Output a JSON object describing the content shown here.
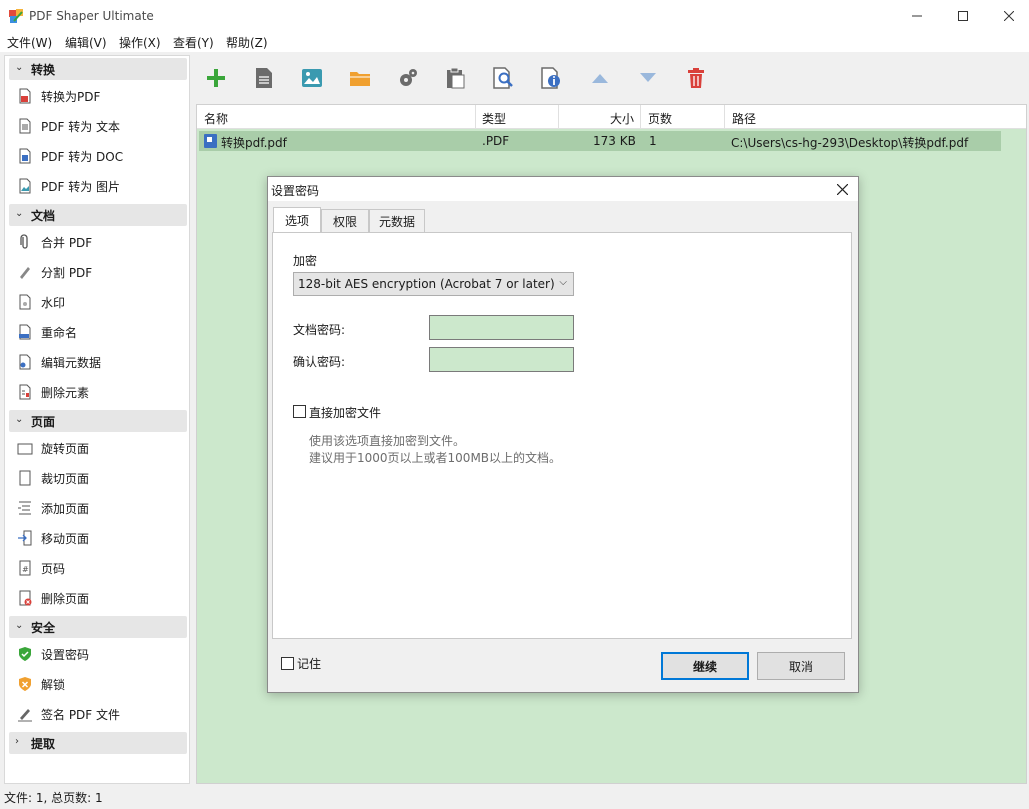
{
  "window": {
    "title": "PDF Shaper Ultimate"
  },
  "menu": [
    "文件(W)",
    "编辑(V)",
    "操作(X)",
    "查看(Y)",
    "帮助(Z)"
  ],
  "sidebar": {
    "sections": [
      {
        "label": "转换",
        "items": [
          "转换为PDF",
          "PDF 转为 文本",
          "PDF 转为 DOC",
          "PDF 转为 图片"
        ]
      },
      {
        "label": "文档",
        "items": [
          "合并 PDF",
          "分割 PDF",
          "水印",
          "重命名",
          "编辑元数据",
          "删除元素"
        ]
      },
      {
        "label": "页面",
        "items": [
          "旋转页面",
          "裁切页面",
          "添加页面",
          "移动页面",
          "页码",
          "删除页面"
        ]
      },
      {
        "label": "安全",
        "items": [
          "设置密码",
          "解锁",
          "签名 PDF 文件"
        ]
      },
      {
        "label": "提取",
        "items": []
      }
    ]
  },
  "toolbar": {
    "icons": [
      "add-icon",
      "document-icon",
      "image-icon",
      "folder-icon",
      "settings-icon",
      "clipboard-icon",
      "search-document-icon",
      "info-icon",
      "arrow-up-icon",
      "arrow-down-icon",
      "delete-icon"
    ],
    "colors": {
      "green": "#3aa63a",
      "gray": "#6b6b6b",
      "teal": "#3a9ab0",
      "orange": "#f0a030",
      "lightblue": "#9ab8dc",
      "red": "#d9403a"
    }
  },
  "file_list": {
    "columns": [
      "名称",
      "类型",
      "大小",
      "页数",
      "路径"
    ],
    "rows": [
      {
        "name": "转换pdf.pdf",
        "type": ".PDF",
        "size": "173 KB",
        "pages": "1",
        "path": "C:\\Users\\cs-hg-293\\Desktop\\转换pdf.pdf"
      }
    ]
  },
  "dialog": {
    "title": "设置密码",
    "tabs": [
      "选项",
      "权限",
      "元数据"
    ],
    "encryption_label": "加密",
    "encryption_value": "128-bit AES encryption (Acrobat 7 or later)",
    "doc_password_label": "文档密码:",
    "confirm_password_label": "确认密码:",
    "direct_encrypt_label": "直接加密文件",
    "hint_line1": "使用该选项直接加密到文件。",
    "hint_line2": "建议用于1000页以上或者100MB以上的文档。",
    "remember_label": "记住",
    "continue_label": "继续",
    "cancel_label": "取消"
  },
  "status": {
    "text": "文件: 1, 总页数: 1"
  },
  "colors": {
    "list_bg": "#cce8cc",
    "row_selected": "#a9cda9",
    "accent": "#0078d7"
  }
}
